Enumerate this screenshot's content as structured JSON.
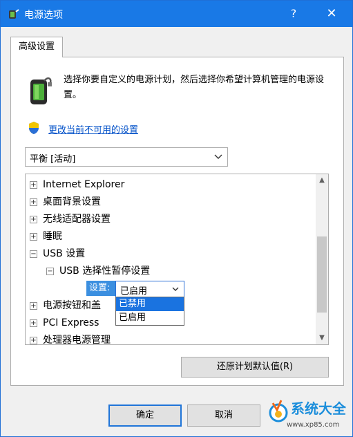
{
  "window": {
    "title": "电源选项",
    "help_glyph": "?",
    "close_glyph": "✕"
  },
  "tabs": [
    {
      "label": "高级设置",
      "active": true
    }
  ],
  "description": "选择你要自定义的电源计划，然后选择你希望计算机管理的电源设置。",
  "change_settings_link": "更改当前不可用的设置",
  "plan_select": {
    "value": "平衡 [活动]"
  },
  "tree": {
    "items": [
      {
        "expander": "+",
        "label": "Internet Explorer"
      },
      {
        "expander": "+",
        "label": "桌面背景设置"
      },
      {
        "expander": "+",
        "label": "无线适配器设置"
      },
      {
        "expander": "+",
        "label": "睡眠"
      },
      {
        "expander": "−",
        "label": "USB 设置"
      },
      {
        "expander": "−",
        "label": "USB 选择性暂停设置"
      },
      {
        "expander": "+",
        "label": "电源按钮和盖"
      },
      {
        "expander": "+",
        "label": "PCI Express"
      },
      {
        "expander": "+",
        "label": "处理器电源管理"
      }
    ],
    "setting_label": "设置:",
    "combo_value": "已启用",
    "dropdown_options": [
      {
        "label": "已禁用",
        "selected": true
      },
      {
        "label": "已启用",
        "selected": false
      }
    ]
  },
  "buttons": {
    "restore_defaults": "还原计划默认值(R)",
    "ok": "确定",
    "cancel": "取消"
  },
  "watermark": {
    "text": "系统大全",
    "url": "www.xp85.com"
  },
  "colors": {
    "titlebar": "#1979e6",
    "selection": "#1a73e0",
    "link": "#0050c8"
  }
}
